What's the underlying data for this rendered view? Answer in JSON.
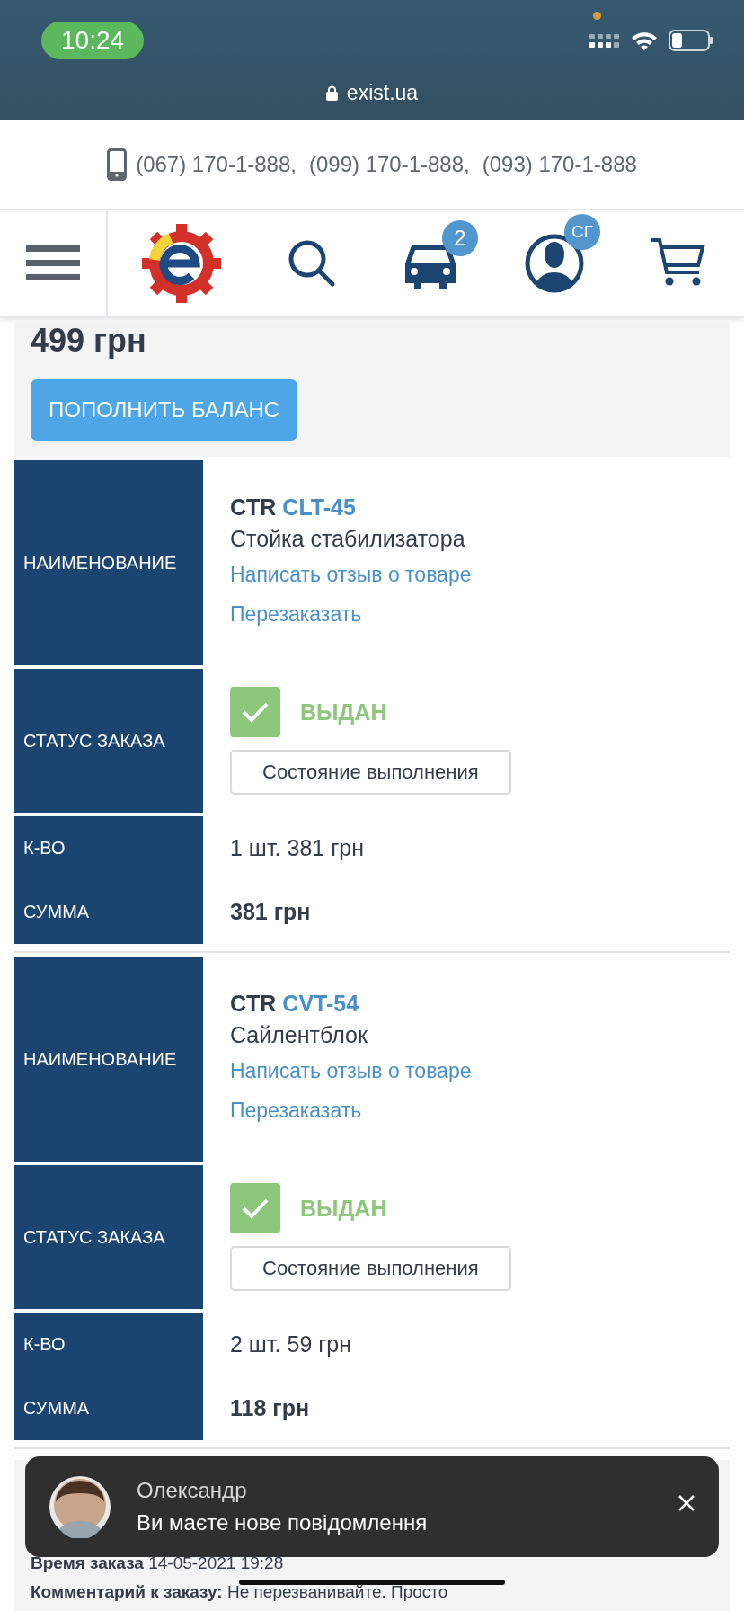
{
  "status_bar": {
    "time": "10:24",
    "url": "exist.ua"
  },
  "contacts": {
    "phones": [
      "(067) 170-1-888,",
      "(099) 170-1-888,",
      "(093) 170-1-888"
    ]
  },
  "nav": {
    "car_badge": "2",
    "profile_badge": "СГ"
  },
  "balance": {
    "amount": "499 грн",
    "button": "ПОПОЛНИТЬ БАЛАНС"
  },
  "items": [
    {
      "name_label": "НАИМЕНОВАНИЕ",
      "brand": "CTR",
      "code": "CLT-45",
      "name": "Стойка стабилизатора",
      "review_link": "Написать отзыв о товаре",
      "reorder_link": "Перезаказать",
      "status_label": "СТАТУС ЗАКАЗА",
      "checked": true,
      "status": "ВЫДАН",
      "progress_button": "Состояние выполнения",
      "qty_label": "К-ВО",
      "qty": "1 шт. 381 грн",
      "sum_label": "СУММА",
      "sum": "381 грн"
    },
    {
      "name_label": "НАИМЕНОВАНИЕ",
      "brand": "CTR",
      "code": "CVT-54",
      "name": "Сайлентблок",
      "review_link": "Написать отзыв о товаре",
      "reorder_link": "Перезаказать",
      "status_label": "СТАТУС ЗАКАЗА",
      "checked": true,
      "status": "ВЫДАН",
      "progress_button": "Состояние выполнения",
      "qty_label": "К-ВО",
      "qty": "2 шт. 59 грн",
      "sum_label": "СУММА",
      "sum": "118 грн"
    }
  ],
  "order_info": [
    {
      "label": "Время заказа",
      "value": "14-05-2021 19:28"
    },
    {
      "label": "Комментарий к заказу:",
      "value": "Не перезванивайте. Просто"
    }
  ],
  "notification": {
    "sender": "Олександр",
    "message": "Ви маєте нове повідомлення"
  }
}
